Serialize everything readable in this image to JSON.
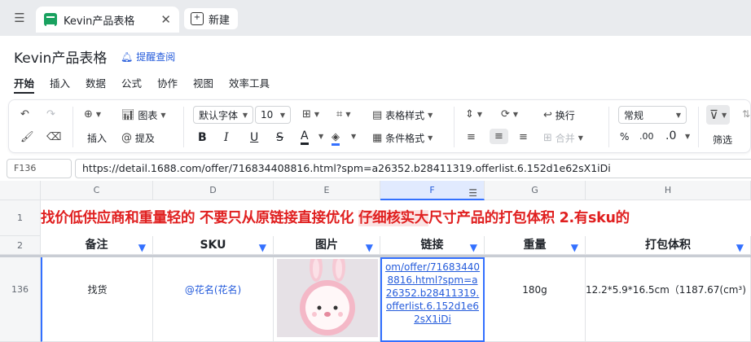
{
  "tabs": [
    {
      "title": "Kevin产品表格",
      "active": true
    },
    {
      "title": "新建",
      "active": false
    }
  ],
  "document": {
    "title": "Kevin产品表格",
    "remind_label": "提醒查阅"
  },
  "menu": [
    "开始",
    "插入",
    "数据",
    "公式",
    "协作",
    "视图",
    "效率工具"
  ],
  "toolbar": {
    "undo": "undo-icon",
    "insert_label": "插入",
    "chart_label": "图表",
    "mention_label": "提及",
    "font_name": "默认字体",
    "font_size": "10",
    "table_style_label": "表格样式",
    "conditional_format_label": "条件格式",
    "wrap_label": "换行",
    "merge_label": "合并",
    "number_format": "常规",
    "percent": "%",
    "decimal_increase": ".00",
    "decimal_decrease": ".0",
    "filter_label": "筛选"
  },
  "formula_bar": {
    "cell_ref": "F136",
    "value": "https://detail.1688.com/offer/716834408816.html?spm=a26352.b28411319.offerlist.6.152d1e62sX1iDi"
  },
  "columns": [
    "C",
    "D",
    "E",
    "F",
    "G",
    "H"
  ],
  "rows": {
    "row1_num": "1",
    "row1_text_a": "找价低供应商和重量轻的 不要只从原链接直接优化 ",
    "row1_text_b": "仔细核实大",
    "row1_text_c": "尺寸产品的打包体积 2.有sku的",
    "row2_num": "2",
    "headers": [
      "备注",
      "SKU",
      "图片",
      "链接",
      "重量",
      "打包体积"
    ],
    "row136_num": "136",
    "row136": {
      "note": "找货",
      "sku": "@花名(花名)",
      "link": "om/offer/716834408816.html?spm=a26352.b28411319.offerlist.6.152d1e62sX1iDi",
      "weight": "180g",
      "volume": "12.2*5.9*16.5cm（1187.67(cm³)"
    }
  }
}
